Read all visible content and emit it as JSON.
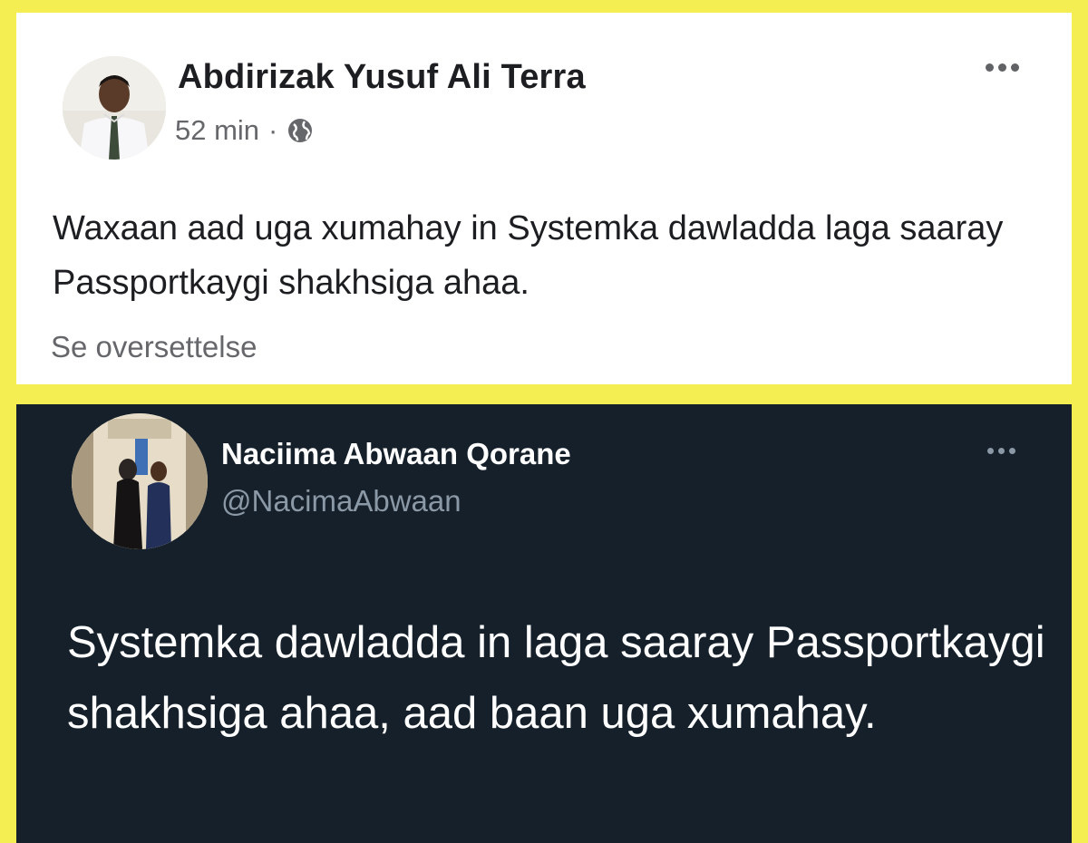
{
  "facebook_post": {
    "author": "Abdirizak Yusuf Ali Terra",
    "time": "52 min",
    "separator": "·",
    "privacy_icon": "globe-icon",
    "more_icon": "more-options-icon",
    "text": "Waxaan aad uga xumahay in Systemka dawladda laga saaray Passportkaygi shakhsiga ahaa.",
    "translate_link": "Se oversettelse"
  },
  "tweet": {
    "name": "Naciima Abwaan Qorane",
    "handle": "@NacimaAbwaan",
    "more_icon": "more-options-icon",
    "text": "Systemka dawladda in laga saaray Passportkaygi shakhsiga ahaa, aad baan uga xumahay."
  },
  "colors": {
    "frame_background": "#f4ee52",
    "tweet_background": "#15202b",
    "fb_secondary_text": "#65676b",
    "tw_secondary_text": "#8b98a5"
  }
}
